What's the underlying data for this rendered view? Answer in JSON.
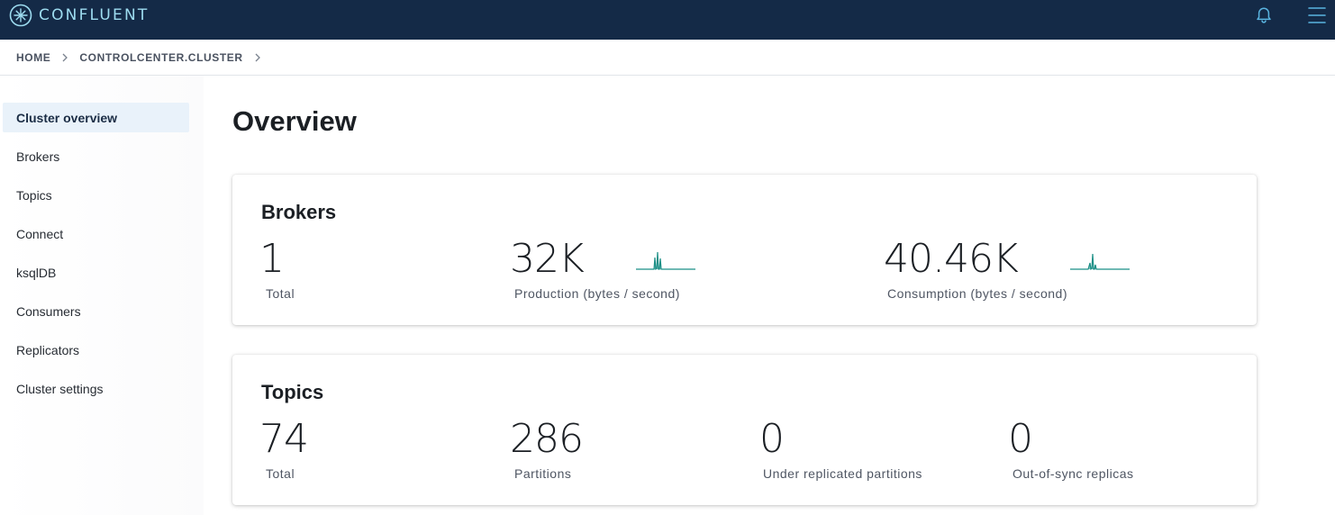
{
  "app": {
    "brand_name": "CONFLUENT",
    "brand_color": "#9ddcf0",
    "topbar_color": "#142a47",
    "icons": [
      "confluent-logo-icon",
      "bell-icon",
      "hamburger-menu-icon"
    ]
  },
  "breadcrumb": {
    "items": [
      "HOME",
      "CONTROLCENTER.CLUSTER"
    ]
  },
  "sidebar": {
    "items": [
      {
        "label": "Cluster overview",
        "active": true
      },
      {
        "label": "Brokers",
        "active": false
      },
      {
        "label": "Topics",
        "active": false
      },
      {
        "label": "Connect",
        "active": false
      },
      {
        "label": "ksqlDB",
        "active": false
      },
      {
        "label": "Consumers",
        "active": false
      },
      {
        "label": "Replicators",
        "active": false
      },
      {
        "label": "Cluster settings",
        "active": false
      }
    ]
  },
  "main": {
    "title": "Overview",
    "brokers_card": {
      "title": "Brokers",
      "total_value": "1",
      "total_label": "Total",
      "production_value": "32K",
      "production_label": "Production (bytes / second)",
      "consumption_value": "40.46K",
      "consumption_label": "Consumption (bytes / second)",
      "sparkline_color": "#1b8f86"
    },
    "topics_card": {
      "title": "Topics",
      "total_value": "74",
      "total_label": "Total",
      "partitions_value": "286",
      "partitions_label": "Partitions",
      "under_replicated_value": "0",
      "under_replicated_label": "Under replicated partitions",
      "out_of_sync_value": "0",
      "out_of_sync_label": "Out-of-sync replicas"
    }
  }
}
